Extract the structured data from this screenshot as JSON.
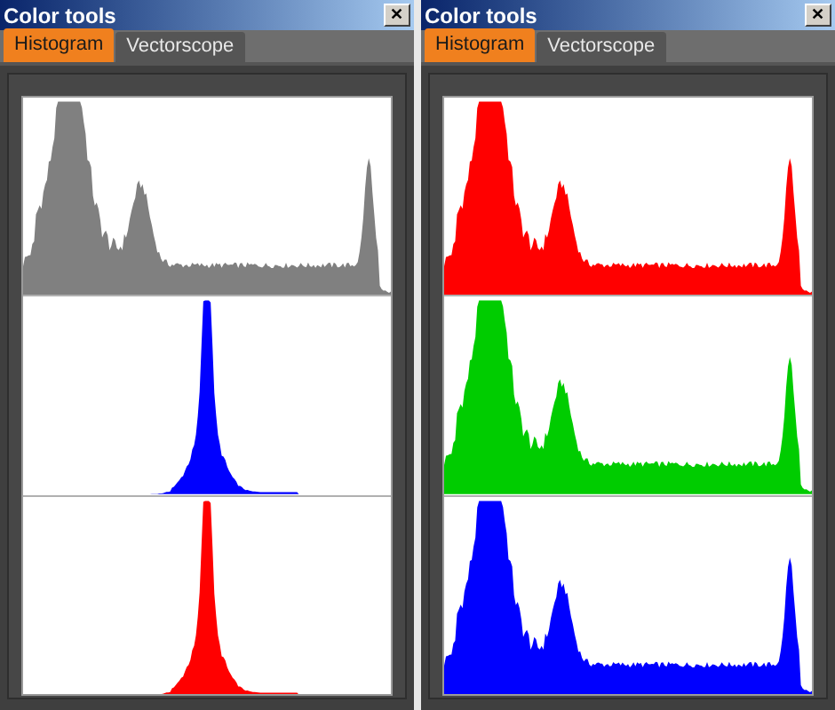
{
  "panels": [
    {
      "title": "Color tools",
      "close": "✕",
      "tabs": [
        {
          "label": "Histogram",
          "selected": true
        },
        {
          "label": "Vectorscope",
          "selected": false
        }
      ],
      "histograms": [
        {
          "kind": "spread",
          "color": "#808080"
        },
        {
          "kind": "peak",
          "color": "#0000ff"
        },
        {
          "kind": "peak",
          "color": "#ff0000"
        }
      ]
    },
    {
      "title": "Color tools",
      "close": "✕",
      "tabs": [
        {
          "label": "Histogram",
          "selected": true
        },
        {
          "label": "Vectorscope",
          "selected": false
        }
      ],
      "histograms": [
        {
          "kind": "spread",
          "color": "#ff0000"
        },
        {
          "kind": "spread",
          "color": "#00cc00"
        },
        {
          "kind": "spread",
          "color": "#0000ff"
        }
      ]
    }
  ]
}
